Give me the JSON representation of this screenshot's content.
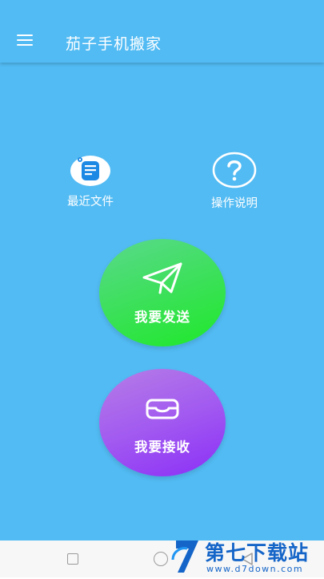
{
  "app": {
    "title": "茄子手机搬家"
  },
  "shortcuts": {
    "recent_files": {
      "label": "最近文件",
      "icon": "document-list-icon"
    },
    "instructions": {
      "label": "操作说明",
      "icon": "question-mark-icon"
    }
  },
  "actions": {
    "send": {
      "label": "我要发送",
      "icon": "paper-plane-icon"
    },
    "receive": {
      "label": "我要接收",
      "icon": "inbox-tray-icon"
    }
  },
  "watermark": {
    "title": "第七下载站",
    "url": "www.d7down.com"
  },
  "colors": {
    "background": "#52bbf3",
    "send_start": "#5ad98d",
    "send_end": "#1fe92a",
    "receive_start": "#b67de6",
    "receive_end": "#8b2ef7",
    "watermark": "#1565c8"
  }
}
